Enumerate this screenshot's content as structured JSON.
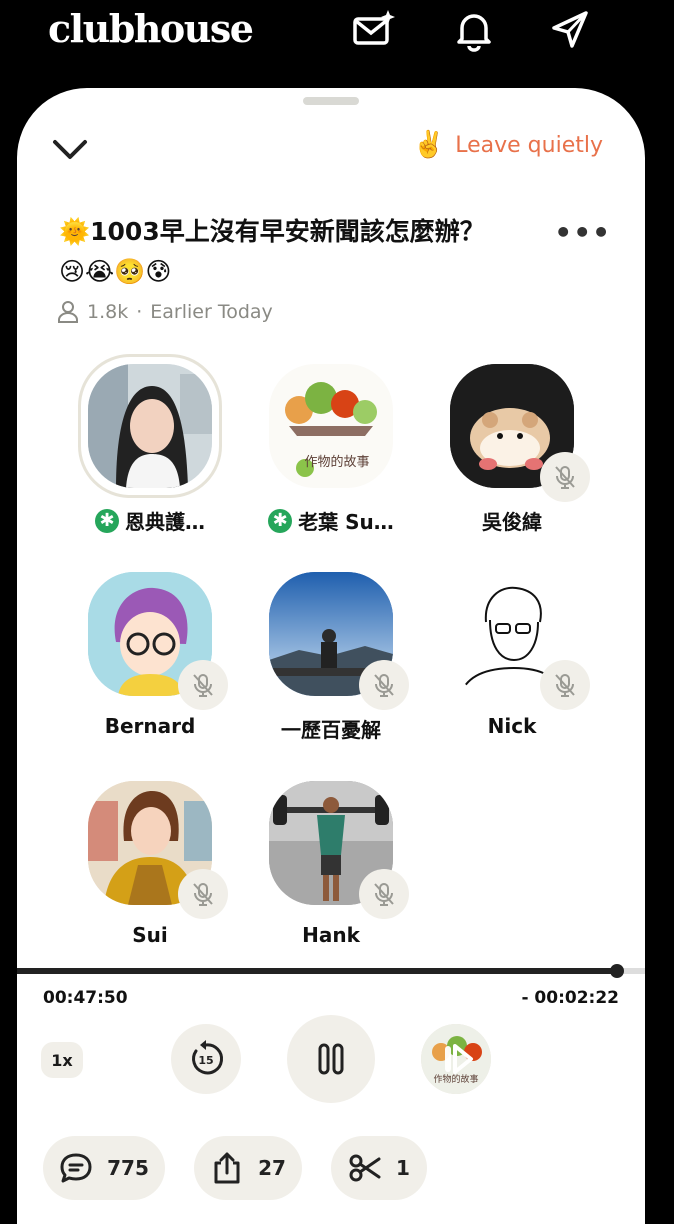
{
  "app": {
    "logo": "clubhouse"
  },
  "header": {
    "leave_label": "Leave quietly",
    "leave_emoji": "✌️"
  },
  "room": {
    "title_line1": "🌞1003早上沒有早安新聞該怎麼辦？",
    "title_line2": "😢😭🥺😰",
    "listeners": "1.8k",
    "separator": "·",
    "time_label": "Earlier Today",
    "more_label": "•••"
  },
  "speakers": [
    {
      "name": "恩典護…",
      "moderator": true,
      "muted": false,
      "ring": true,
      "avatar": "woman-portrait"
    },
    {
      "name": "老葉 Su…",
      "moderator": true,
      "muted": false,
      "ring": false,
      "avatar": "vegetables-illustration",
      "avatar_text": "作物的故事"
    },
    {
      "name": "吳俊緯",
      "moderator": false,
      "muted": true,
      "ring": false,
      "avatar": "hamster-plush"
    },
    {
      "name": "Bernard",
      "moderator": false,
      "muted": true,
      "ring": false,
      "avatar": "anime-character"
    },
    {
      "name": "一歷百憂解",
      "moderator": false,
      "muted": true,
      "ring": false,
      "avatar": "person-sky"
    },
    {
      "name": "Nick",
      "moderator": false,
      "muted": true,
      "ring": false,
      "avatar": "line-sketch"
    },
    {
      "name": "Sui",
      "moderator": false,
      "muted": true,
      "ring": false,
      "avatar": "woman-kimono"
    },
    {
      "name": "Hank",
      "moderator": false,
      "muted": true,
      "ring": false,
      "avatar": "gym-man"
    }
  ],
  "player": {
    "elapsed": "00:47:50",
    "remaining": "- 00:02:22",
    "progress": 0.955,
    "speed": "1x",
    "rewind_seconds": "15",
    "next_thumb_text": "作物的故事"
  },
  "actions": {
    "comments": "775",
    "shares": "27",
    "clips": "1"
  },
  "colors": {
    "accent": "#e8714a",
    "moderator": "#26a65b",
    "chip": "#f1efe9"
  }
}
